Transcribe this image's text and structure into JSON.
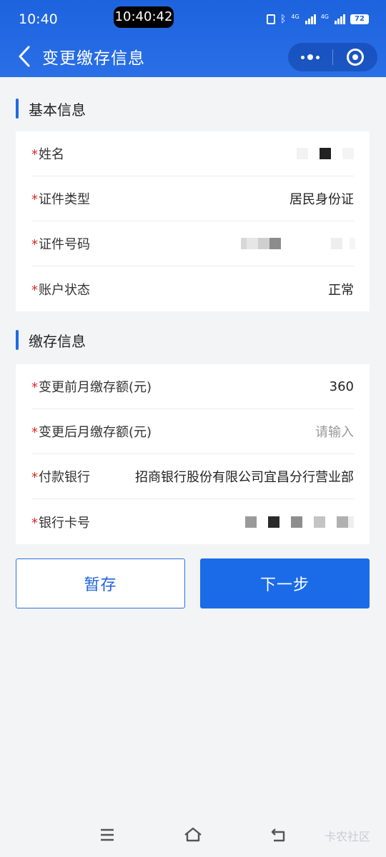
{
  "status_bar": {
    "time": "10:40",
    "clock_badge": "10:40:42",
    "network_1": "4G",
    "network_2": "4G",
    "battery": "72"
  },
  "header": {
    "title": "变更缴存信息",
    "back_icon": "chevron-left-icon",
    "more_icon": "more-dots-icon",
    "close_icon": "target-circle-icon"
  },
  "basic_section": {
    "title": "基本信息",
    "rows": [
      {
        "required": "*",
        "label": "姓名",
        "value": ""
      },
      {
        "required": "*",
        "label": "证件类型",
        "value": "居民身份证"
      },
      {
        "required": "*",
        "label": "证件号码",
        "value": ""
      },
      {
        "required": "*",
        "label": "账户状态",
        "value": "正常"
      }
    ]
  },
  "deposit_section": {
    "title": "缴存信息",
    "rows": [
      {
        "required": "*",
        "label": "变更前月缴存额(元)",
        "value": "360"
      },
      {
        "required": "*",
        "label": "变更后月缴存额(元)",
        "placeholder": "请输入"
      },
      {
        "required": "*",
        "label": "付款银行",
        "value": "招商银行股份有限公司宜昌分行营业部"
      },
      {
        "required": "*",
        "label": "银行卡号",
        "value": ""
      }
    ]
  },
  "buttons": {
    "save": "暂存",
    "next": "下一步"
  },
  "nav": {
    "menu_icon": "menu-icon",
    "home_icon": "home-icon",
    "back_icon": "back-arrow-icon"
  },
  "watermark": "卡农社区",
  "colors": {
    "brand": "#1b6be8",
    "required": "#e02424",
    "background": "#f3f4f6"
  }
}
